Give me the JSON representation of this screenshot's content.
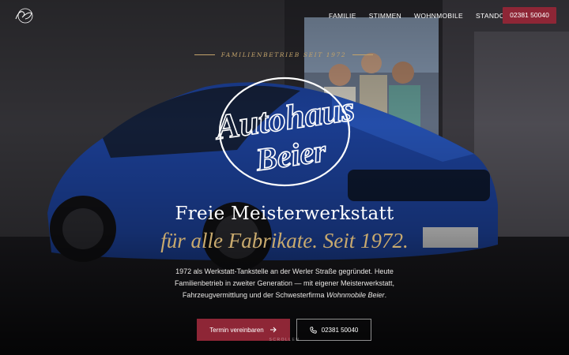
{
  "nav": {
    "logo_alt": "Autohaus Beier",
    "items": [
      {
        "label": "FAMILIE"
      },
      {
        "label": "STIMMEN"
      },
      {
        "label": "WOHNMOBILE"
      },
      {
        "label": "STANDORT"
      }
    ],
    "phone_label": "02381 50040"
  },
  "hero": {
    "tagline": "FAMILIENBETRIEB SEIT 1972",
    "logo_text_line1": "Autohaus",
    "logo_text_line2": "Beier",
    "headline": "Freie Meisterwerkstatt",
    "subheadline": "für alle Fabrikate. Seit 1972.",
    "description_part1": "1972 als Werkstatt-Tankstelle an der Werler Straße gegründet. Heute Familienbetrieb in zweiter Generation — mit eigener Meisterwerkstatt, Fahrzeugvermittlung und der Schwesterfirma ",
    "description_brand": "Wohnmobile Beier",
    "description_end": ".",
    "cta_primary": "Termin vereinbaren",
    "cta_secondary": "02381 50040",
    "scroll_hint": "SCROLLEN"
  },
  "colors": {
    "accent": "#8e2636",
    "gold": "#c9aa6e"
  }
}
